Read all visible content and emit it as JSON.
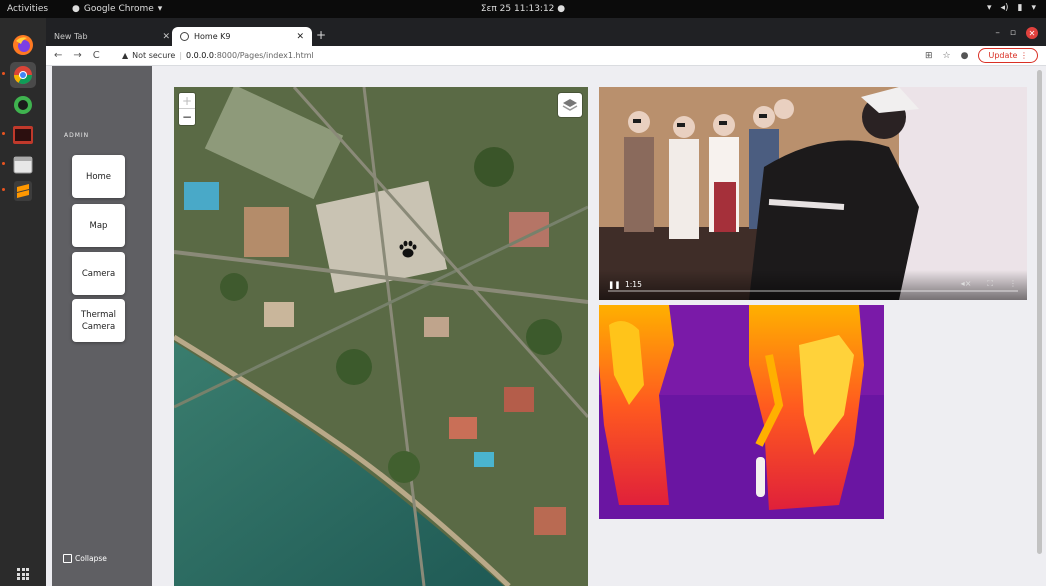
{
  "system_bar": {
    "activities": "Activities",
    "app_menu": "Google Chrome",
    "clock": "Σεπ 25  11:13:12"
  },
  "browser": {
    "tabs": [
      {
        "label": "New Tab"
      },
      {
        "label": "Home K9"
      }
    ],
    "security_label": "Not secure",
    "url_host": "0.0.0.0",
    "url_path": ":8000/Pages/index1.html",
    "update_label": "Update"
  },
  "sidebar": {
    "heading": "ADMIN",
    "items": [
      {
        "label": "Home"
      },
      {
        "label": "Map"
      },
      {
        "label": "Camera"
      },
      {
        "label": "Thermal Camera"
      }
    ],
    "collapse_label": "Collapse"
  },
  "map": {
    "zoom_in": "+",
    "zoom_out": "−",
    "marker_icon": "paw-icon",
    "layers_icon": "layers-icon"
  },
  "video": {
    "current_time": "1:15",
    "progress": 0.0,
    "state": "playing"
  },
  "colors": {
    "sidebar_bg": "#5f5f63",
    "page_bg": "#eeeef2",
    "update_accent": "#d93025",
    "dock_bg": "#2b2b2b"
  }
}
